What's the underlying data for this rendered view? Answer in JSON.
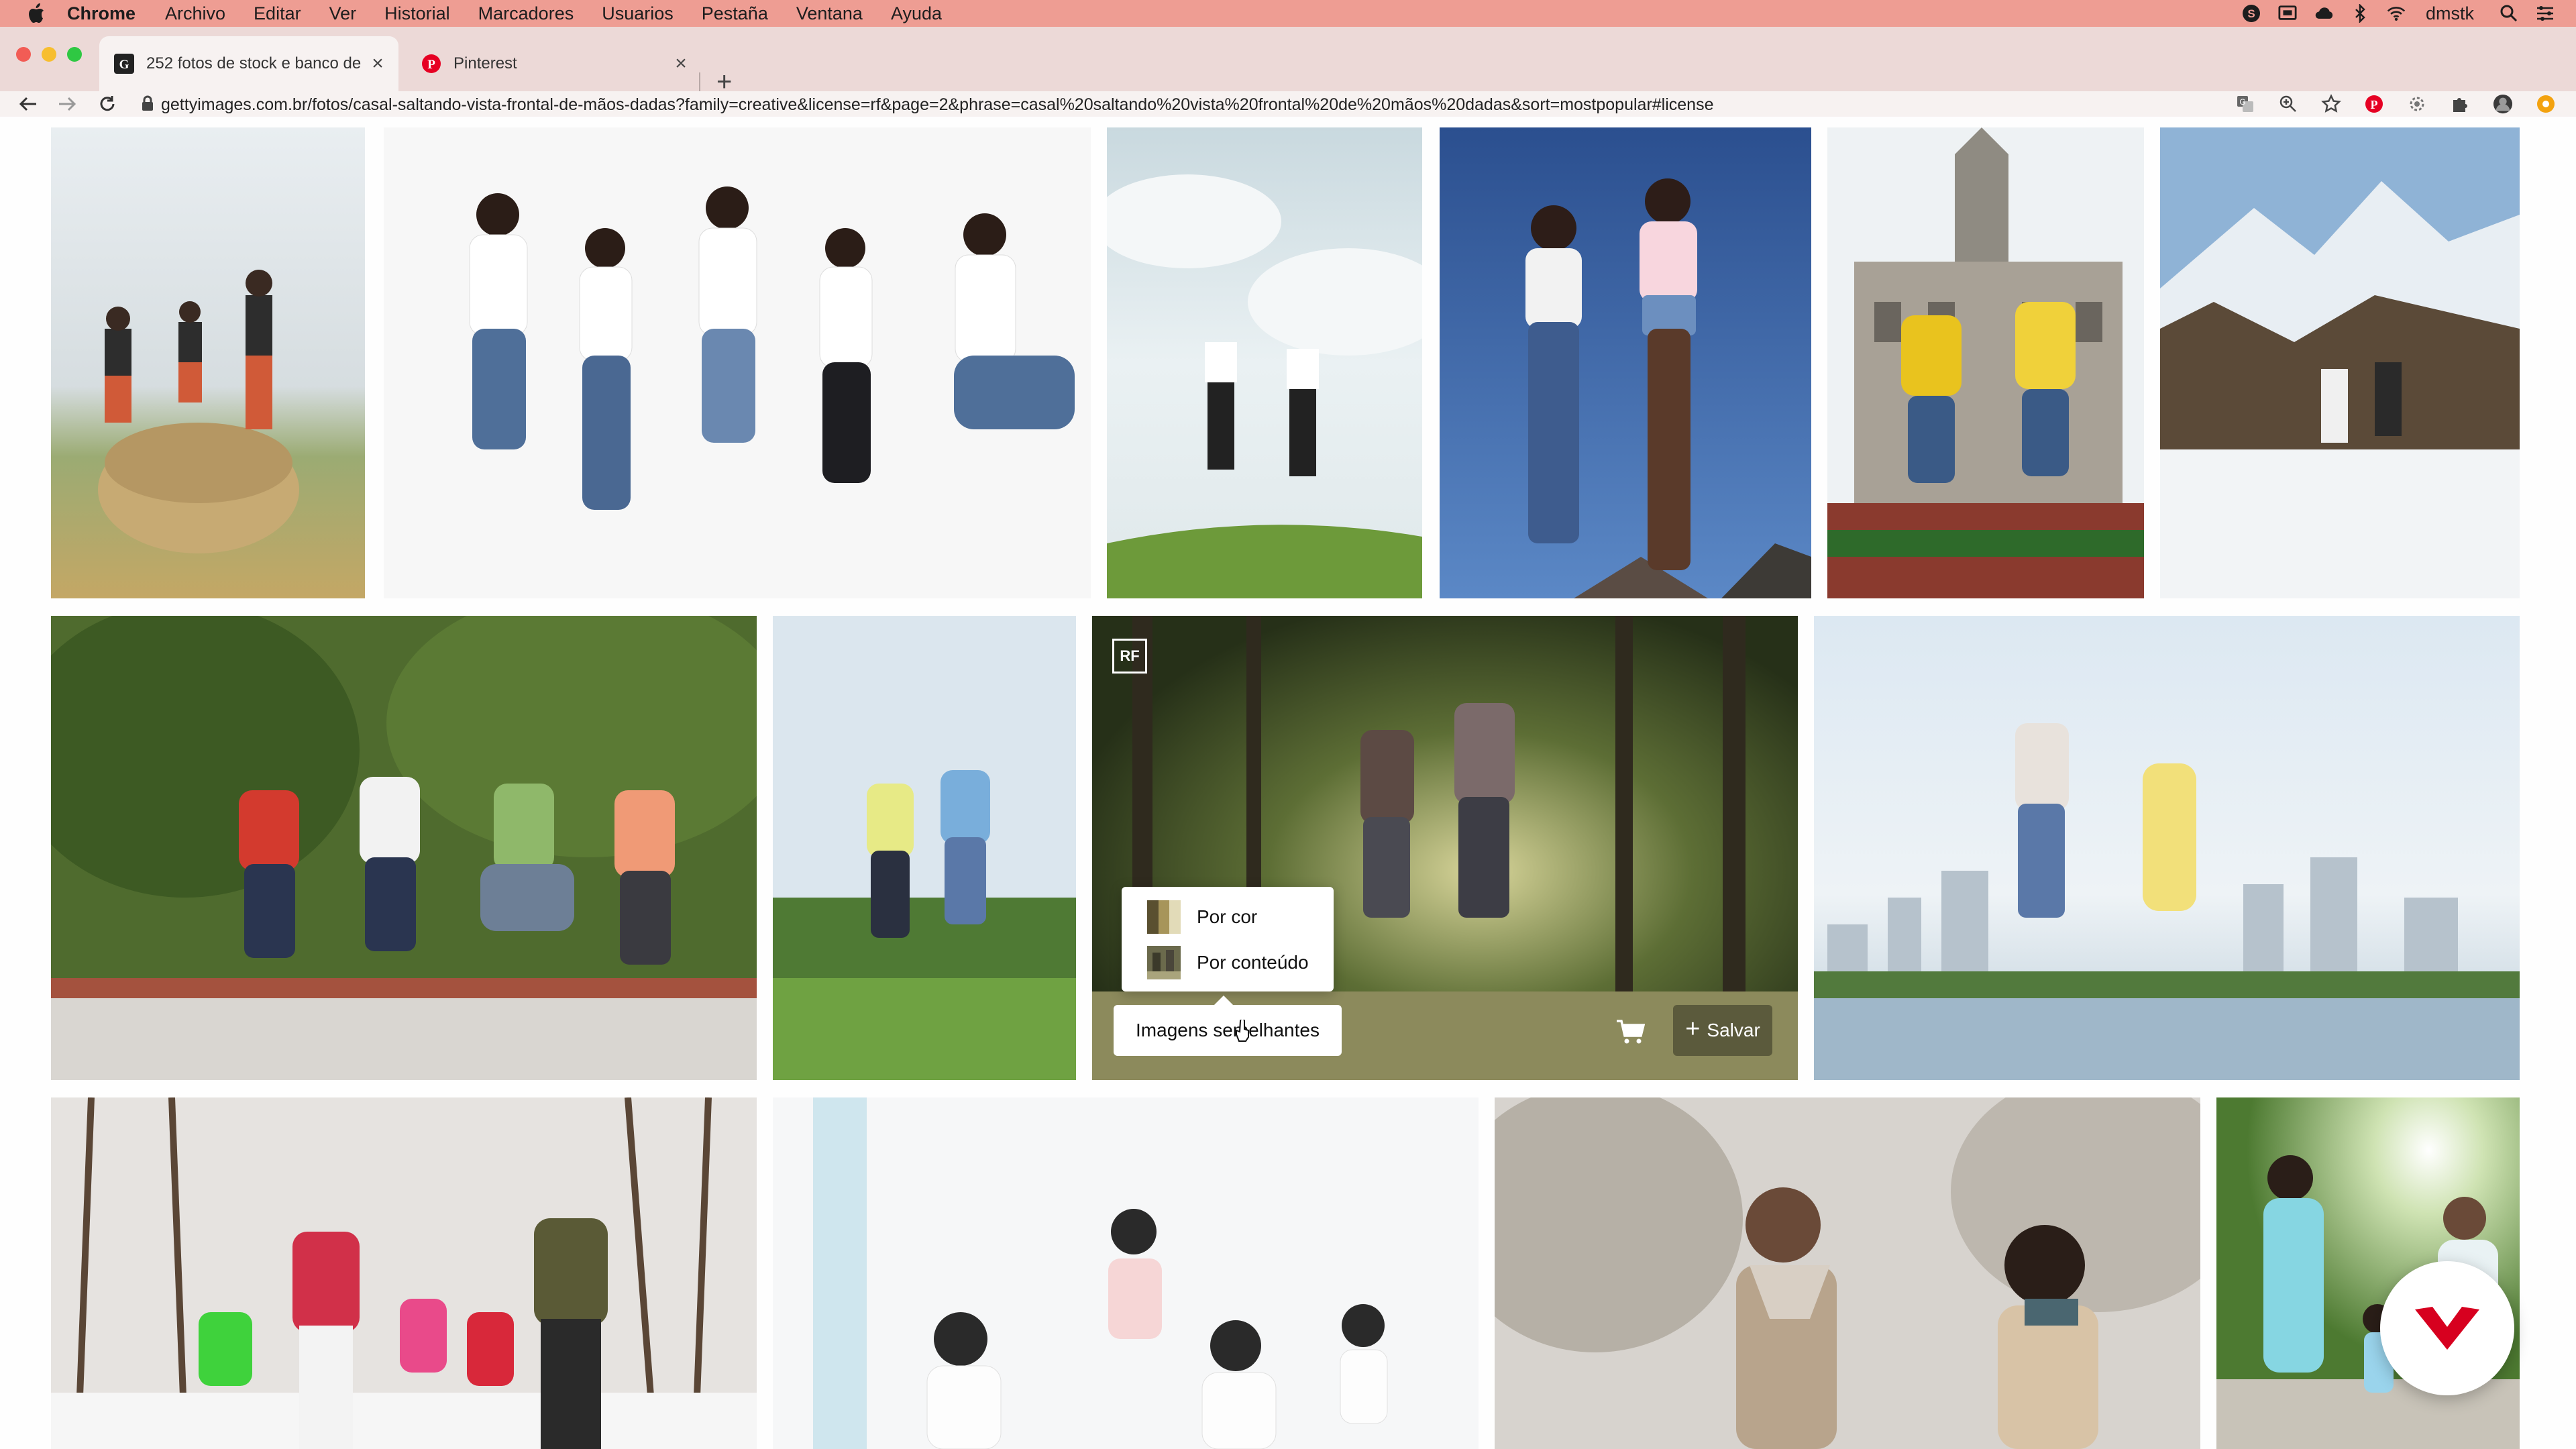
{
  "menubar": {
    "app": "Chrome",
    "items": [
      "Archivo",
      "Editar",
      "Ver",
      "Historial",
      "Marcadores",
      "Usuarios",
      "Pestaña",
      "Ventana",
      "Ayuda"
    ],
    "user": "dmstk",
    "icons": [
      "skype-icon",
      "screen-icon",
      "creative-cloud-icon",
      "bluetooth-icon",
      "wifi-icon",
      "spotlight-search-icon",
      "control-center-icon"
    ]
  },
  "tabs": [
    {
      "title": "252 fotos de stock e banco de",
      "favicon": "gettyimages-icon",
      "active": true
    },
    {
      "title": "Pinterest",
      "favicon": "pinterest-icon",
      "active": false
    }
  ],
  "address": {
    "url": "gettyimages.com.br/fotos/casal-saltando-vista-frontal-de-mãos-dadas?family=creative&license=rf&page=2&phrase=casal%20saltando%20vista%20frontal%20de%20mãos%20dadas&sort=mostpopular#license"
  },
  "overlay": {
    "badge": "RF",
    "popup": {
      "by_color": "Por cor",
      "by_content": "Por conteúdo"
    },
    "similar_button": "Imagens semelhantes",
    "save_button": "Salvar"
  },
  "colors": {
    "menubar": "#ee9d93",
    "tabstrip": "#ecd9d7",
    "toolbar": "#f7f2f1",
    "accent": "#d7001f"
  }
}
